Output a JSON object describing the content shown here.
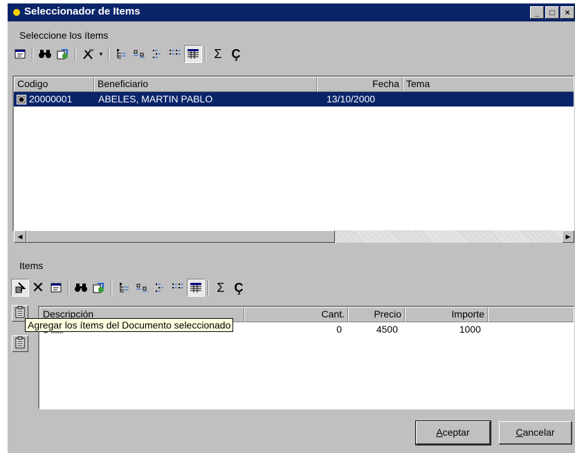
{
  "window": {
    "title": "Seleccionador de Items",
    "controls": [
      "_",
      "□",
      "×"
    ]
  },
  "top_section": {
    "label": "Seleccione los ítems",
    "toolbar": [
      {
        "name": "properties-icon",
        "glyph": "🗔"
      },
      {
        "name": "binoculars-icon",
        "glyph": "🔭"
      },
      {
        "name": "refresh-icon",
        "glyph": "🔄"
      },
      {
        "name": "tools-icon",
        "glyph": "⚒"
      },
      {
        "name": "tree-view-icon",
        "glyph": "⋮"
      },
      {
        "name": "large-icons-icon",
        "glyph": "▫"
      },
      {
        "name": "small-icons-icon",
        "glyph": "⁘"
      },
      {
        "name": "list-view-icon",
        "glyph": "☰"
      },
      {
        "name": "details-view-icon",
        "glyph": "▦"
      },
      {
        "name": "sum-icon",
        "glyph": "Σ"
      },
      {
        "name": "filter-icon",
        "glyph": "Ç"
      }
    ],
    "columns": [
      "Codigo",
      "Beneficiario",
      "Fecha",
      "Tema"
    ],
    "rows": [
      {
        "codigo": "20000001",
        "beneficiario": "ABELES, MARTIN PABLO",
        "fecha": "13/10/2000",
        "tema": ""
      }
    ]
  },
  "bottom_section": {
    "label": "Items",
    "columns": [
      "Descripción",
      "Cant.",
      "Precio",
      "Importe"
    ],
    "rows": [
      {
        "descripcion": "",
        "cant": "0",
        "precio": "4500",
        "importe": "1000"
      }
    ],
    "tooltip": "Agregar los ítems del Documento seleccionado"
  },
  "buttons": {
    "accept_prefix": "A",
    "accept_rest": "ceptar",
    "cancel_prefix": "C",
    "cancel_rest": "ancelar"
  }
}
